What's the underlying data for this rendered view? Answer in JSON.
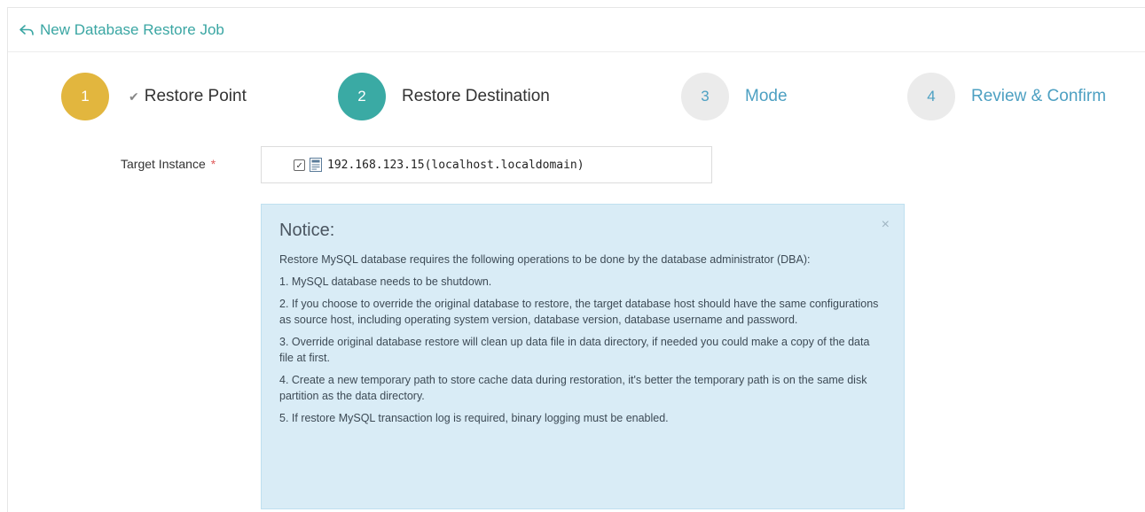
{
  "header": {
    "title": "New Database Restore Job"
  },
  "steps": [
    {
      "number": "1",
      "label": "Restore Point"
    },
    {
      "number": "2",
      "label": "Restore Destination"
    },
    {
      "number": "3",
      "label": "Mode"
    },
    {
      "number": "4",
      "label": "Review & Confirm"
    }
  ],
  "form": {
    "target_label": "Target Instance",
    "required_mark": "*",
    "target_value": "192.168.123.15(localhost.localdomain)"
  },
  "notice": {
    "title": "Notice:",
    "close": "×",
    "lines": [
      "Restore MySQL database requires the following operations to be done by the database administrator (DBA):",
      "1. MySQL database needs to be shutdown.",
      "2. If you choose to override the original database to restore, the target database host should have the same configurations as source host, including operating system version, database version, database username and password.",
      "3. Override original database restore will clean up data file in data directory, if needed you could make a copy of the data file at first.",
      "4. Create a new temporary path to store cache data during restoration, it's better the temporary path is on the same disk partition as the data directory.",
      "5. If restore MySQL transaction log is required, binary logging must be enabled."
    ]
  },
  "colors": {
    "accent": "#3aa6a3",
    "step_done": "#e2b63e",
    "step_active": "#3aaaa4",
    "step_pending_text": "#4da0c2",
    "notice_bg": "#d9ecf6"
  }
}
